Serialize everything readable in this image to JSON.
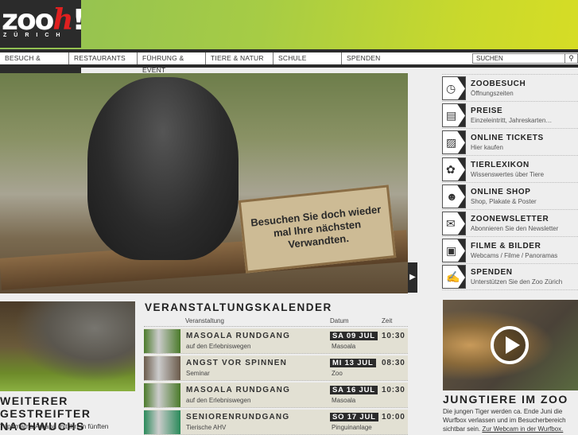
{
  "logo": {
    "word": "zoo",
    "h": "h",
    "bang": "!",
    "sub": "ZÜRICH"
  },
  "nav": [
    "BESUCH & TICKETS",
    "RESTAURANTS",
    "FÜHRUNG & EVENT",
    "TIERE & NATUR",
    "SCHULE",
    "SPENDEN"
  ],
  "search": {
    "placeholder": "SUCHEN",
    "icon": "search-icon"
  },
  "hero": {
    "sign": "Besuchen Sie doch wieder mal Ihre nächsten Verwandten."
  },
  "sidebar": [
    {
      "title": "ZOOBESUCH",
      "sub": "Öffnungszeiten",
      "icon": "clock-icon"
    },
    {
      "title": "PREISE",
      "sub": "Einzeleintritt, Jahreskarten…",
      "icon": "cash-register-icon"
    },
    {
      "title": "ONLINE TICKETS",
      "sub": "Hier kaufen",
      "icon": "tickets-icon"
    },
    {
      "title": "TIERLEXIKON",
      "sub": "Wissenswertes über Tiere",
      "icon": "lion-icon"
    },
    {
      "title": "ONLINE SHOP",
      "sub": "Shop, Plakate & Poster",
      "icon": "teddy-bear-icon"
    },
    {
      "title": "ZOONEWSLETTER",
      "sub": "Abonnieren Sie den Newsletter",
      "icon": "envelope-icon"
    },
    {
      "title": "FILME & BILDER",
      "sub": "Webcams / Filme / Panoramas",
      "icon": "camera-icon"
    },
    {
      "title": "SPENDEN",
      "sub": "Unterstützen Sie den Zoo Zürich",
      "icon": "donate-hand-icon"
    }
  ],
  "news": {
    "title": "WEITERER GESTREIFTER NACHWUCHS",
    "text": "Tapirmama Amapa mit ihrem fünften"
  },
  "calendar": {
    "title": "VERANSTALTUNGSKALENDER",
    "headers": {
      "event": "Veranstaltung",
      "date": "Datum",
      "time": "Zeit"
    },
    "rows": [
      {
        "name": "MASOALA RUNDGANG",
        "sub": "auf den Erlebniswegen",
        "date": "SA 09 JUL",
        "place": "Masoala",
        "time": "10:30",
        "thumb": "#4a7a2a"
      },
      {
        "name": "ANGST VOR SPINNEN",
        "sub": "Seminar",
        "date": "MI 13 JUL",
        "place": "Zoo",
        "time": "08:30",
        "thumb": "#6a5a4a"
      },
      {
        "name": "MASOALA RUNDGANG",
        "sub": "auf den Erlebniswegen",
        "date": "SA 16 JUL",
        "place": "Masoala",
        "time": "10:30",
        "thumb": "#4a7a2a"
      },
      {
        "name": "SENIORENRUNDGANG",
        "sub": "Tierische AHV",
        "date": "SO 17 JUL",
        "place": "Pinguinanlage",
        "time": "10:00",
        "thumb": "#2a8a5a"
      }
    ]
  },
  "video": {
    "title": "JUNGTIERE IM ZOO",
    "text": "Die jungen Tiger werden ca. Ende Juni die Wurfbox verlassen und im Besucherbereich sichtbar sein.",
    "link": "Zur Webcam in der Wurfbox."
  }
}
